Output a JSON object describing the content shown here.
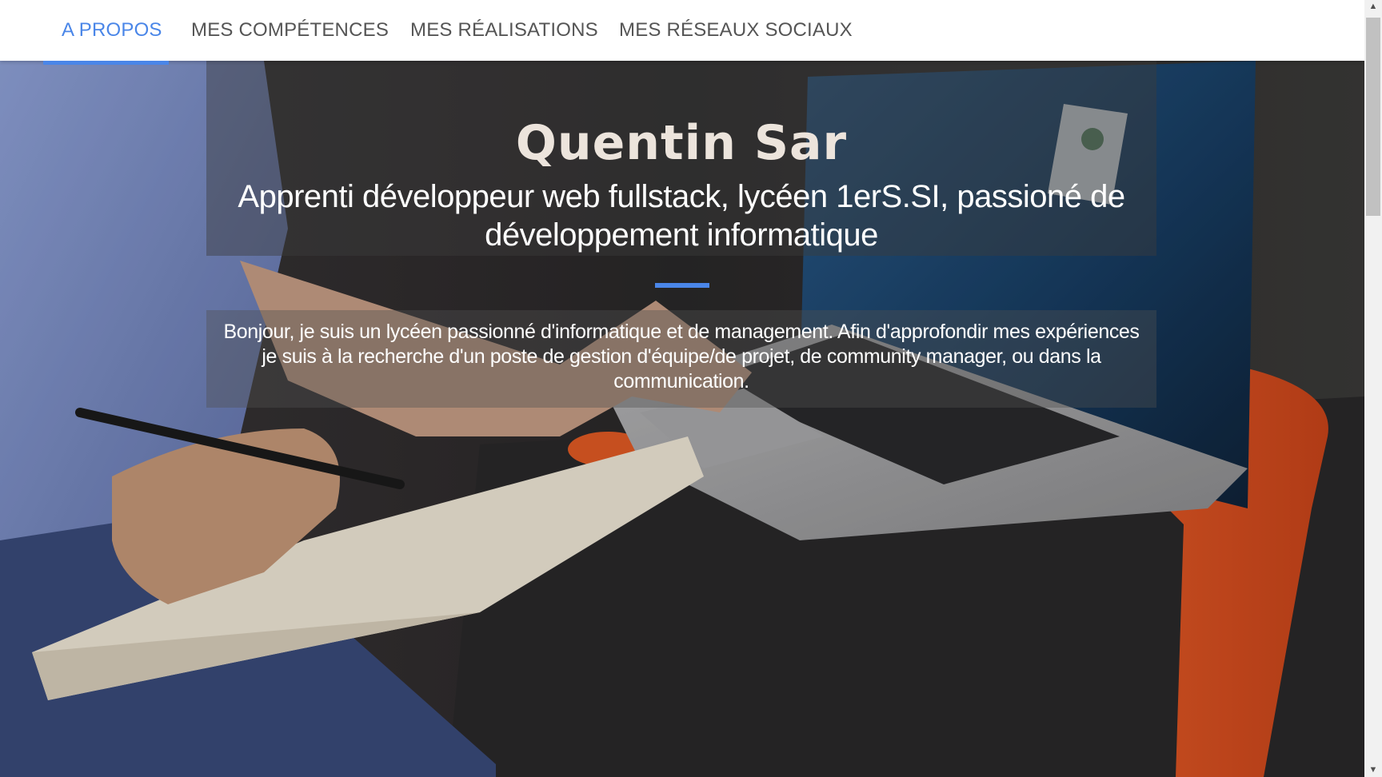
{
  "nav": {
    "tabs": [
      {
        "label": "A PROPOS",
        "active": true
      },
      {
        "label": "MES COMPÉTENCES",
        "active": false
      },
      {
        "label": "MES RÉALISATIONS",
        "active": false
      },
      {
        "label": "MES RÉSEAUX SOCIAUX",
        "active": false
      }
    ]
  },
  "hero": {
    "name": "Quentin Sar",
    "subtitle": "Apprenti développeur web fullstack, lycéen 1erS.SI, passioné de développement informatique",
    "description": "Bonjour, je suis un lycéen passionné d'informatique et de management. Afin d'approfondir mes expériences je suis à la recherche d'un poste de gestion d'équipe/de projet, de community manager, ou dans la communication.",
    "background_image": "person-writing-in-notebook-next-to-laptop-photo"
  },
  "colors": {
    "accent": "#4a86e8",
    "nav_text": "#555555",
    "name_text": "#ece4dc",
    "table_orange": "#e8541c"
  },
  "icons": {
    "scroll_up": "scroll-up-arrow-icon",
    "scroll_down": "scroll-down-arrow-icon"
  }
}
